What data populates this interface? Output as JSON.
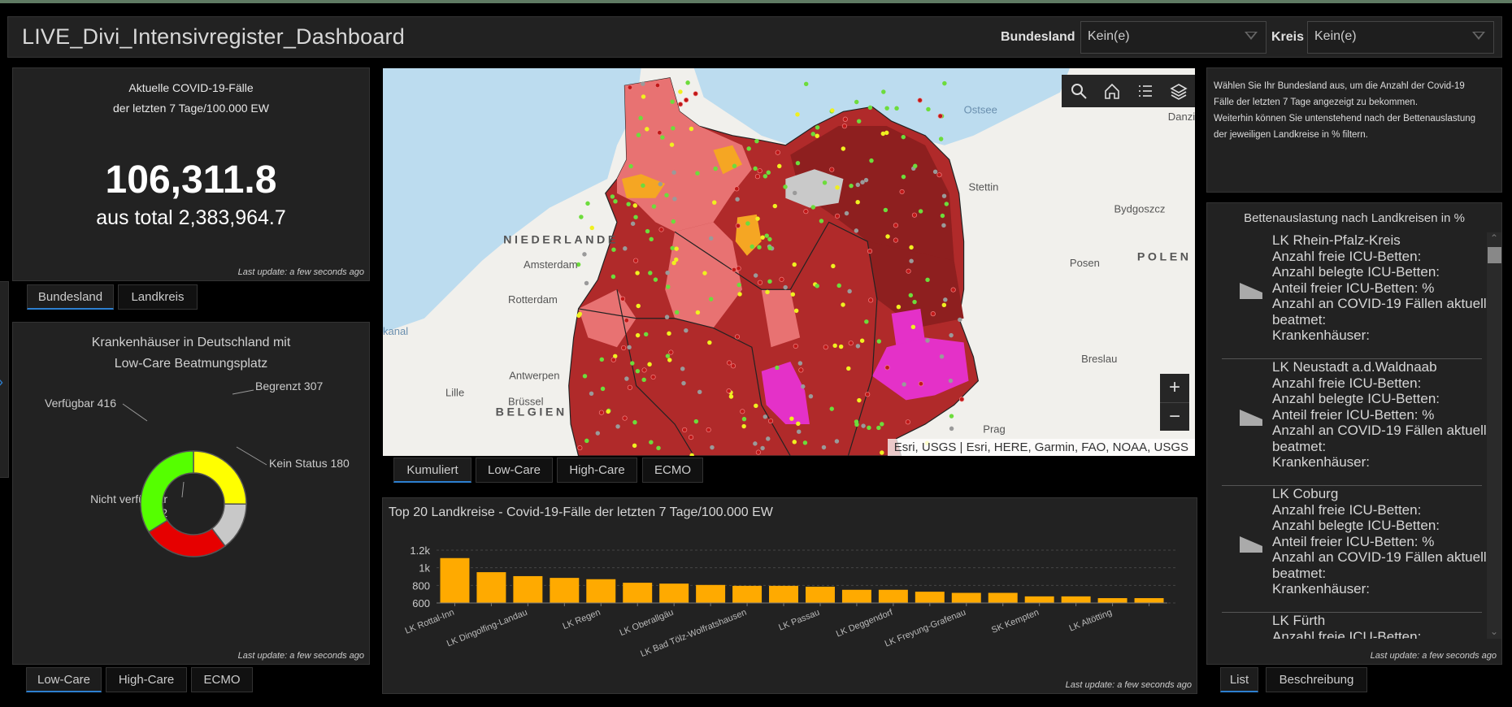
{
  "header": {
    "title": "LIVE_Divi_Intensivregister_Dashboard",
    "bundesland_label": "Bundesland",
    "bundesland_value": "Kein(e)",
    "kreis_label": "Kreis",
    "kreis_value": "Kein(e)"
  },
  "cases": {
    "title_line1": "Aktuelle COVID-19-Fälle",
    "title_line2": "der letzten 7 Tage/100.000 EW",
    "value": "106,311.8",
    "total": "aus total 2,383,964.7",
    "last_update": "Last update: a few seconds ago",
    "tabs": [
      {
        "label": "Bundesland",
        "active": true
      },
      {
        "label": "Landkreis",
        "active": false
      }
    ]
  },
  "hospitals": {
    "title_line1": "Krankenhäuser in Deutschland mit",
    "title_line2": "Low-Care Beatmungsplatz",
    "last_update": "Last update: a few seconds ago",
    "tabs": [
      {
        "label": "Low-Care",
        "active": true
      },
      {
        "label": "High-Care",
        "active": false
      },
      {
        "label": "ECMO",
        "active": false
      }
    ]
  },
  "chart_data": [
    {
      "type": "pie",
      "donut": true,
      "slices": [
        {
          "label": "Begrenzt",
          "value": 307,
          "color": "#ffff00",
          "text": "Begrenzt 307"
        },
        {
          "label": "Kein Status",
          "value": 180,
          "color": "#c8c8c8",
          "text": "Kein Status 180"
        },
        {
          "label": "Nicht verfügbar",
          "value": 322,
          "color": "#e60000",
          "text": "Nicht verfügbar",
          "text2": "322"
        },
        {
          "label": "Verfügbar",
          "value": 416,
          "color": "#55ff00",
          "text": "Verfügbar 416"
        }
      ]
    },
    {
      "type": "bar",
      "title": "Top 20 Landkreise - Covid-19-Fälle der letzten 7 Tage/100.000 EW",
      "ylim": [
        600,
        1200
      ],
      "yticks": [
        "600",
        "800",
        "1k",
        "1.2k"
      ],
      "ytick_values": [
        600,
        800,
        1000,
        1200
      ],
      "grid": true,
      "color": "#ffaa00",
      "categories": [
        "LK Rottal-Inn",
        "",
        "LK Dingolfing-Landau",
        "",
        "LK Regen",
        "",
        "LK Oberallgäu",
        "",
        "LK Bad Tölz-Wolfratshausen",
        "",
        "LK Passau",
        "",
        "LK Deggendorf",
        "",
        "LK Freyung-Grafenau",
        "",
        "SK Kempten",
        "",
        "LK Altötting",
        ""
      ],
      "values": [
        1110,
        950,
        905,
        885,
        870,
        830,
        820,
        805,
        795,
        795,
        785,
        750,
        750,
        728,
        715,
        715,
        675,
        675,
        655,
        655
      ],
      "last_update": "Last update: a few seconds ago"
    }
  ],
  "map": {
    "tools": [
      "search-icon",
      "home-icon",
      "legend-icon",
      "layers-icon"
    ],
    "zoom_in": "+",
    "zoom_out": "−",
    "attribution": "Esri, USGS | Esri, HERE, Garmin, FAO, NOAA, USGS",
    "labels": [
      {
        "t": "Ostsee"
      },
      {
        "t": "Danzig"
      },
      {
        "t": "Stettin"
      },
      {
        "t": "Bydgoszcz"
      },
      {
        "t": "Amsterdam"
      },
      {
        "t": "Posen"
      },
      {
        "t": "Rotterdam"
      },
      {
        "t": "Antwerpen"
      },
      {
        "t": "Breslau"
      },
      {
        "t": "Brüssel"
      },
      {
        "t": "Lille"
      },
      {
        "t": "Prag"
      },
      {
        "t": "kanal"
      }
    ],
    "countries": [
      "NIEDERLANDE",
      "POLEN",
      "BELGIEN"
    ],
    "tabs": [
      {
        "label": "Kumuliert",
        "active": true
      },
      {
        "label": "Low-Care",
        "active": false
      },
      {
        "label": "High-Care",
        "active": false
      },
      {
        "label": "ECMO",
        "active": false
      }
    ]
  },
  "info": {
    "lines": [
      "Wählen Sie Ihr Bundesland aus, um die Anzahl der Covid-19",
      "Fälle der letzten 7 Tage angezeigt zu bekommen.",
      "Weiterhin können Sie untenstehend nach der Bettenauslastung",
      "der jeweiligen Landkreise in % filtern."
    ]
  },
  "beds": {
    "title": "Bettenauslastung nach Landkreisen in %",
    "last_update": "Last update: a few seconds ago",
    "field_lines": [
      "Anzahl freie ICU-Betten:",
      "Anzahl belegte ICU-Betten:",
      "Anteil freier ICU-Betten: %",
      "Anzahl an COVID-19 Fällen aktuell",
      "beatmet:",
      "Krankenhäuser:"
    ],
    "items": [
      {
        "name": "LK Rhein-Pfalz-Kreis"
      },
      {
        "name": "LK Neustadt a.d.Waldnaab"
      },
      {
        "name": "LK Coburg"
      },
      {
        "name": "LK Fürth"
      }
    ],
    "tabs": [
      {
        "label": "List",
        "active": true
      },
      {
        "label": "Beschreibung",
        "active": false
      }
    ]
  }
}
